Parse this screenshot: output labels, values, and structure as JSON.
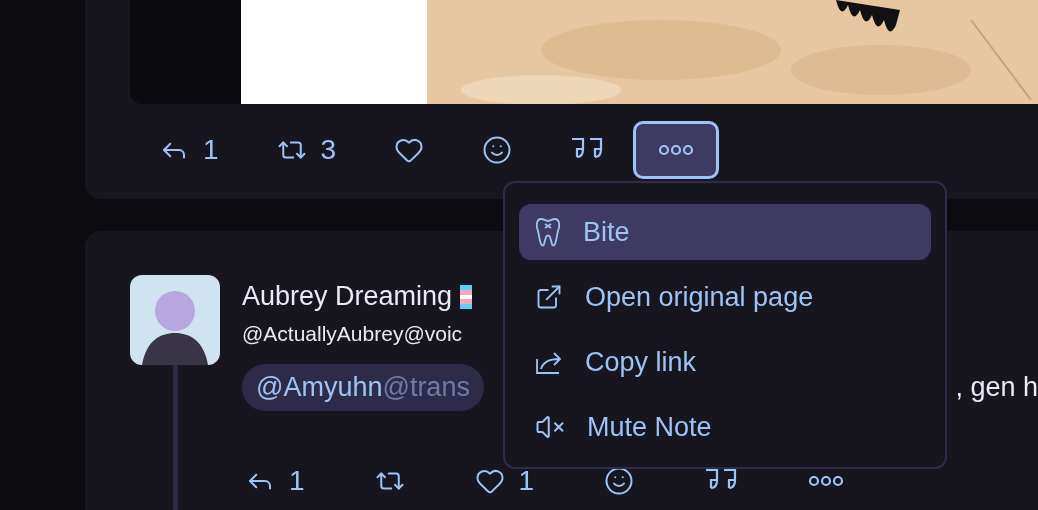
{
  "notes": [
    {
      "kind": "media",
      "actions": [
        {
          "kind": "reply",
          "count": "1",
          "selected": false
        },
        {
          "kind": "repost",
          "count": "3",
          "selected": false
        },
        {
          "kind": "like",
          "selected": false
        },
        {
          "kind": "react",
          "selected": false
        },
        {
          "kind": "quote",
          "selected": false
        },
        {
          "kind": "more",
          "selected": true
        }
      ]
    },
    {
      "kind": "post",
      "author": {
        "name": "Aubrey Dreaming",
        "handle": "@ActuallyAubrey@voic"
      },
      "mention": {
        "user": "@Amyuhn",
        "host": "@trans"
      },
      "text": ", gen h",
      "actions": [
        {
          "kind": "reply",
          "count": "1",
          "selected": false
        },
        {
          "kind": "repost",
          "selected": false
        },
        {
          "kind": "like",
          "count": "1",
          "selected": false
        },
        {
          "kind": "react",
          "selected": false
        },
        {
          "kind": "quote",
          "selected": false
        },
        {
          "kind": "more",
          "selected": false
        }
      ]
    }
  ],
  "menu": {
    "items": [
      {
        "kind": "bite",
        "label": "Bite",
        "selected": true
      },
      {
        "kind": "open",
        "label": "Open original page",
        "selected": false
      },
      {
        "kind": "copy",
        "label": "Copy link",
        "selected": false
      },
      {
        "kind": "mute",
        "label": "Mute Note",
        "selected": false
      }
    ]
  }
}
